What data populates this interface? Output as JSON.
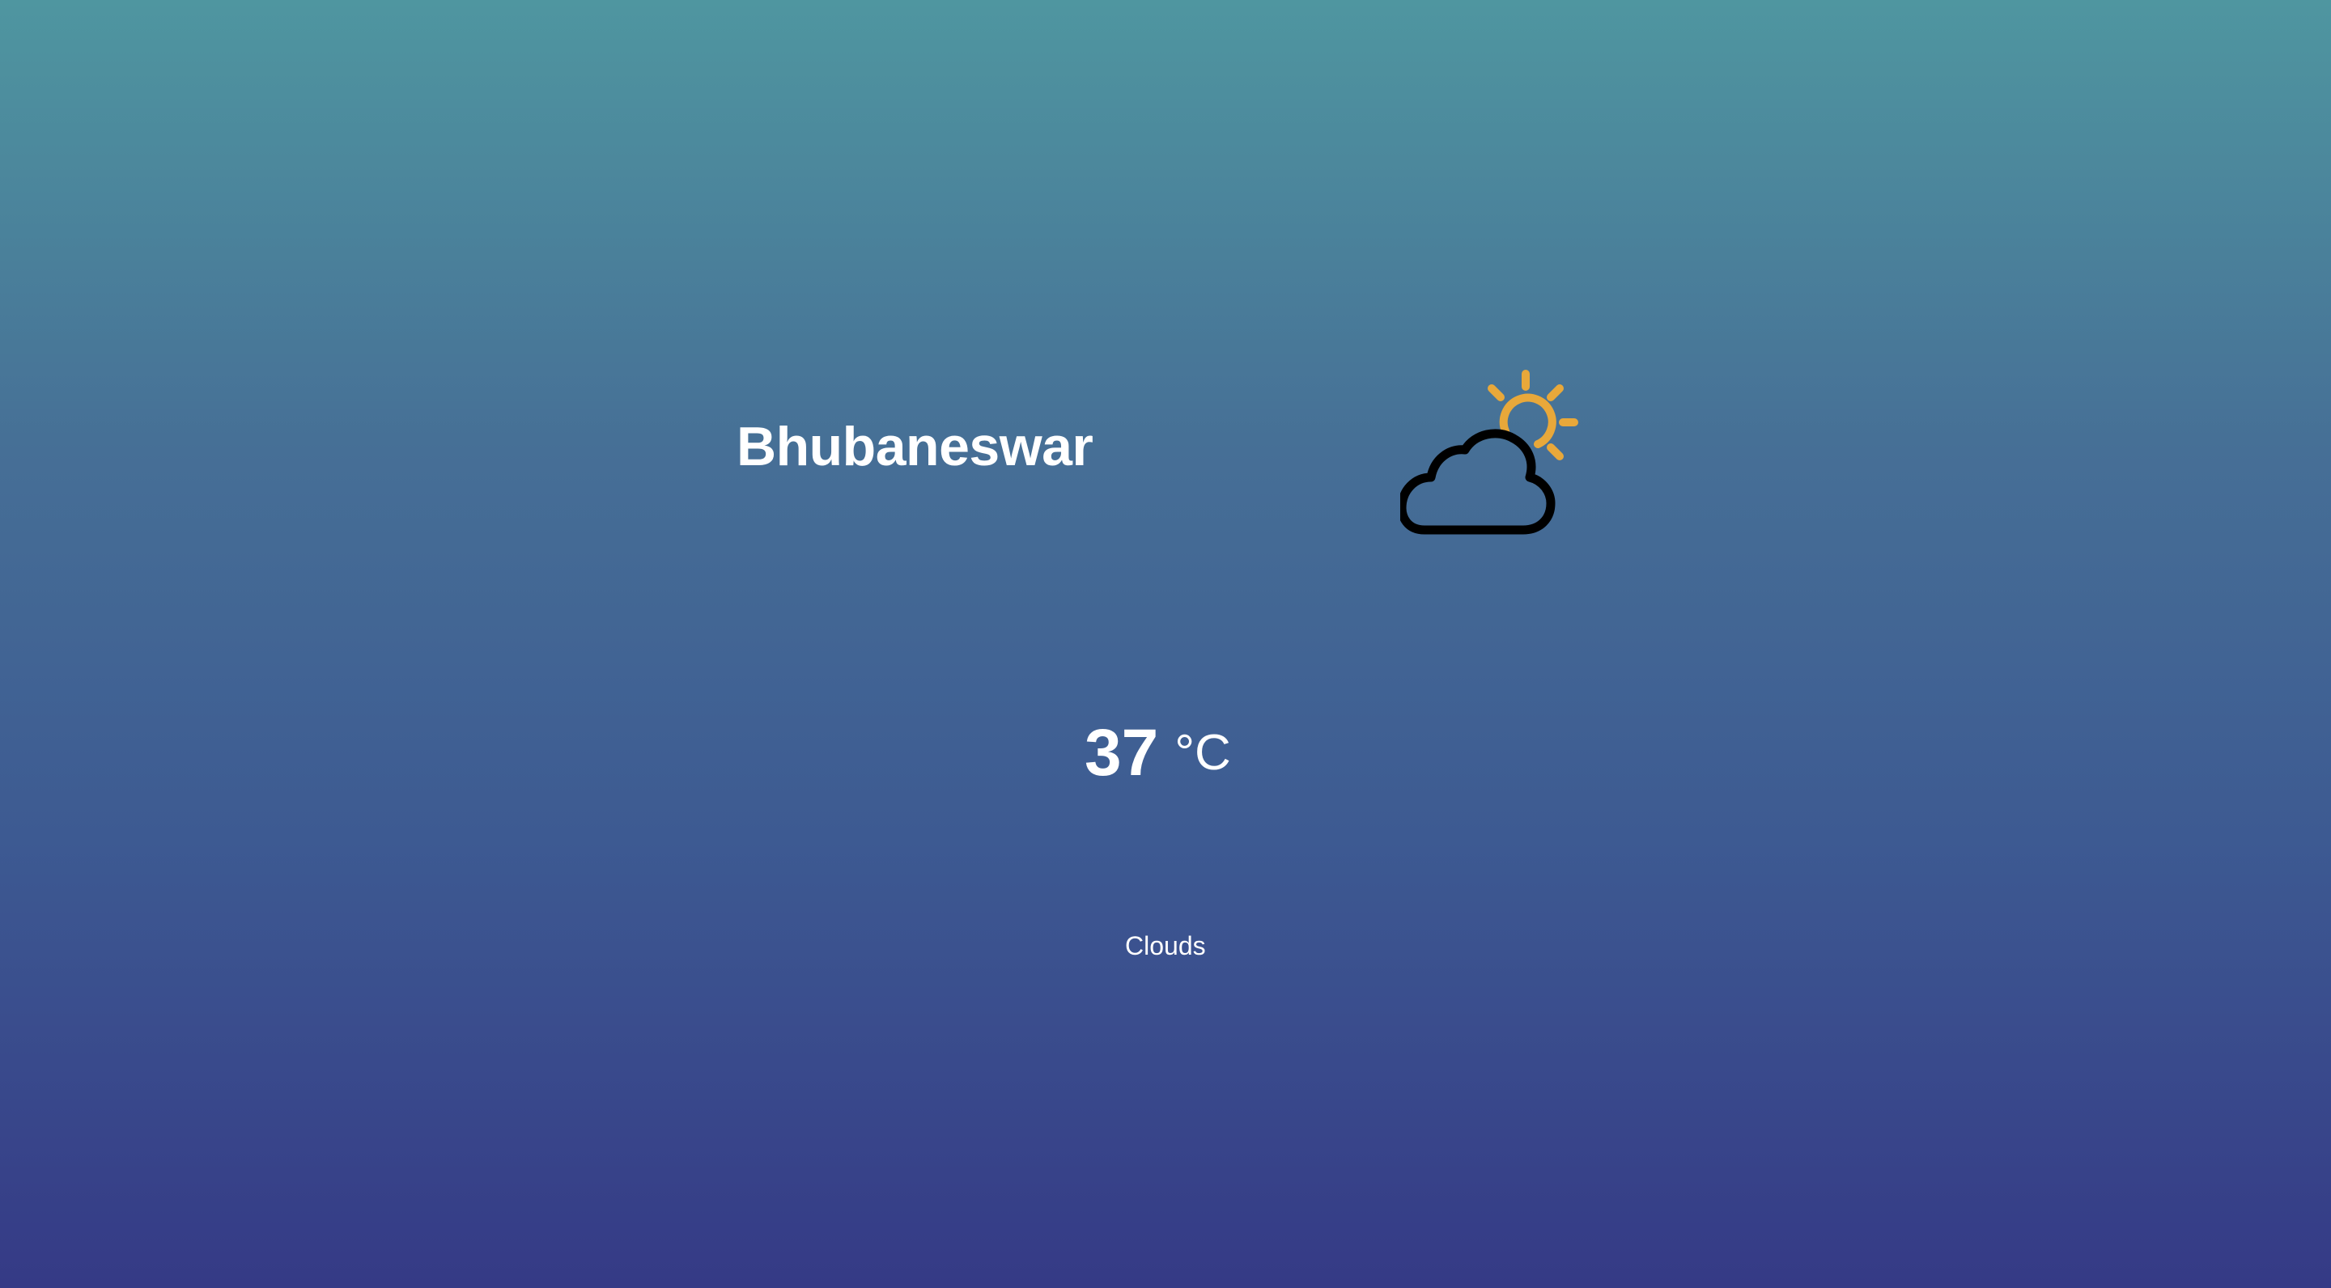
{
  "weather": {
    "city": "Bhubaneswar",
    "temperature": "37",
    "unit": "°C",
    "condition": "Clouds",
    "icon": "partly-cloudy-icon"
  },
  "colors": {
    "background_top": "#4f96a0",
    "background_bottom": "#353a86",
    "sun": "#e8a83a",
    "cloud_outline": "#000000",
    "text": "#ffffff"
  }
}
